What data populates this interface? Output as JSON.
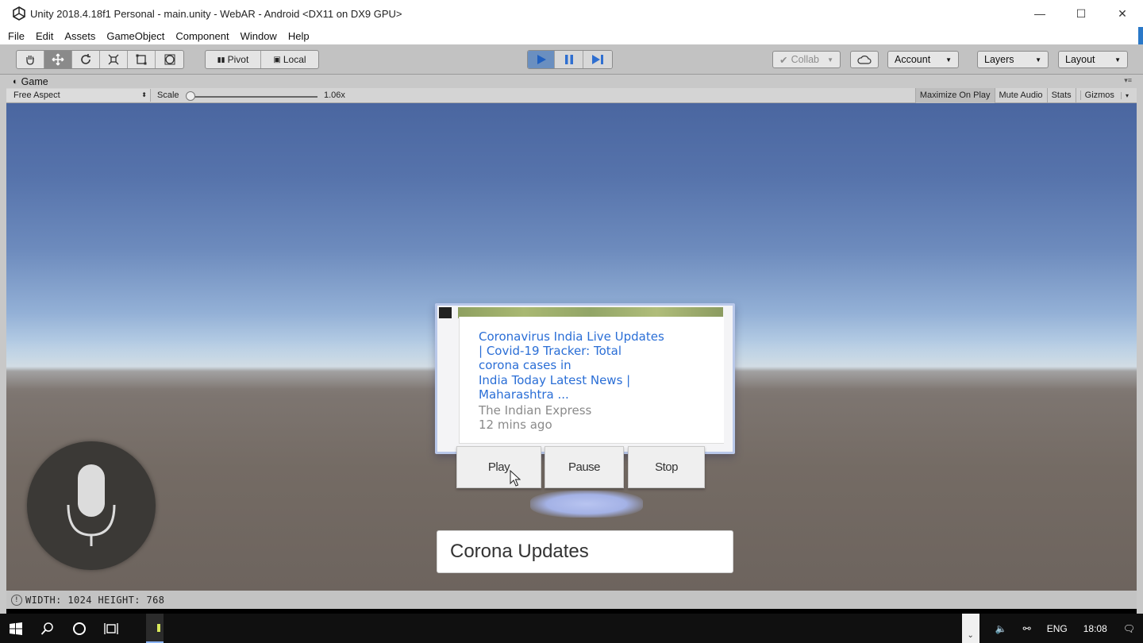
{
  "window": {
    "title": "Unity 2018.4.18f1 Personal - main.unity - WebAR - Android <DX11 on DX9 GPU>",
    "controls": {
      "minimize": "—",
      "maximize": "☐",
      "close": "✕"
    }
  },
  "menubar": [
    "File",
    "Edit",
    "Assets",
    "GameObject",
    "Component",
    "Window",
    "Help"
  ],
  "toolbar": {
    "tools": [
      "hand-tool-icon",
      "move-tool-icon",
      "rotate-tool-icon",
      "scale-tool-icon",
      "rect-tool-icon",
      "transform-tool-icon"
    ],
    "pivot": "Pivot",
    "local": "Local",
    "collab": "Collab",
    "account": "Account",
    "layers": "Layers",
    "layout": "Layout"
  },
  "game_view": {
    "tab": "Game",
    "aspect": "Free Aspect",
    "scale_label": "Scale",
    "scale_value": "1.06x",
    "right_buttons": [
      "Maximize On Play",
      "Mute Audio",
      "Stats",
      "Gizmos"
    ]
  },
  "scene": {
    "news": {
      "headline": "Coronavirus India Live Updates | Covid-19 Tracker: Total corona cases in India Today Latest News | Maharashtra ...",
      "headline_lines": [
        "Coronavirus India Live Updates",
        "| Covid-19 Tracker: Total",
        "corona cases in",
        "India Today Latest News |",
        "Maharashtra ..."
      ],
      "source": "The Indian Express",
      "time": "12 mins ago"
    },
    "buttons": {
      "play": "Play",
      "pause": "Pause",
      "stop": "Stop"
    },
    "label": "Corona Updates"
  },
  "statusbar": {
    "text": "WIDTH: 1024 HEIGHT: 768"
  },
  "taskbar": {
    "language": "ENG",
    "time": "18:08"
  },
  "colors": {
    "link_blue": "#2a6ed6",
    "play_active": "#6a8fc0",
    "taskbar": "#101010"
  }
}
